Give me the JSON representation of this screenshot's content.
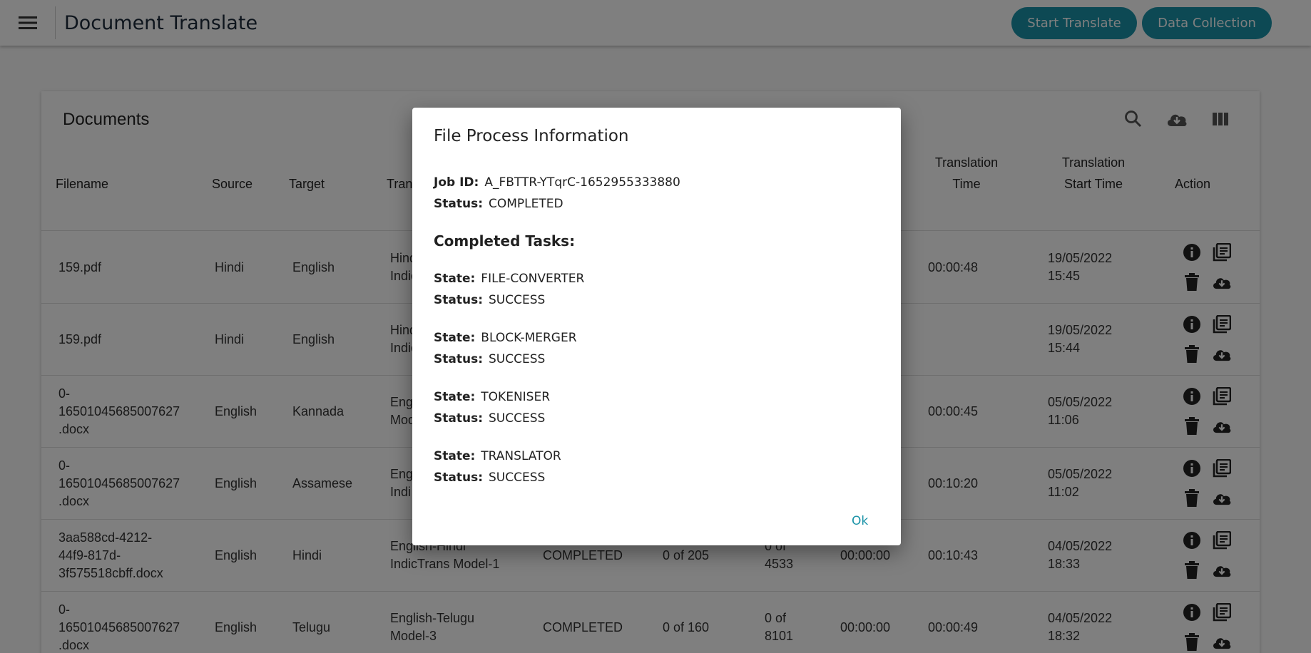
{
  "app": {
    "title": "Document Translate",
    "start_translate": "Start Translate",
    "data_collection": "Data Collection"
  },
  "card": {
    "title": "Documents",
    "headers": {
      "filename": "Filename",
      "source": "Source",
      "target": "Target",
      "trans_partial": "Tran",
      "translation_time_1": "Translation",
      "translation_time_2": "Time",
      "start_time_1": "Translation",
      "start_time_2": "Start Time",
      "action": "Action"
    },
    "rows": [
      {
        "filename": [
          "159.pdf"
        ],
        "source": "Hindi",
        "target": "English",
        "model": [
          "Hind",
          "Indic"
        ],
        "status": "",
        "sentences": "",
        "words": [],
        "zero_time": "",
        "time": "00:00:48",
        "start": [
          "19/05/2022",
          "15:45"
        ]
      },
      {
        "filename": [
          "159.pdf"
        ],
        "source": "Hindi",
        "target": "English",
        "model": [
          "Hind",
          "Indic"
        ],
        "status": "",
        "sentences": "",
        "words": [],
        "zero_time": "",
        "time": "",
        "start": [
          "19/05/2022",
          "15:44"
        ]
      },
      {
        "filename": [
          "0-",
          "16501045685007627",
          ".docx"
        ],
        "source": "English",
        "target": "Kannada",
        "model": [
          "Engl",
          "Mod"
        ],
        "status": "",
        "sentences": "",
        "words": [],
        "zero_time": "",
        "time": "00:00:45",
        "start": [
          "05/05/2022",
          "11:06"
        ]
      },
      {
        "filename": [
          "0-",
          "16501045685007627",
          ".docx"
        ],
        "source": "English",
        "target": "Assamese",
        "model": [
          "Engl",
          "Indi"
        ],
        "status": "",
        "sentences": "",
        "words": [],
        "zero_time": "",
        "time": "00:10:20",
        "start": [
          "05/05/2022",
          "11:02"
        ]
      },
      {
        "filename": [
          "3aa588cd-4212-",
          "44f9-817d-",
          "3f575518cbff.docx"
        ],
        "source": "English",
        "target": "Hindi",
        "model": [
          "English-Hindi",
          "IndicTrans Model-1"
        ],
        "status": "COMPLETED",
        "sentences": "0 of 205",
        "words": [
          "0 of",
          "4533"
        ],
        "zero_time": "00:00:00",
        "time": "00:10:43",
        "start": [
          "04/05/2022",
          "18:33"
        ]
      },
      {
        "filename": [
          "0-",
          "16501045685007627",
          ".docx"
        ],
        "source": "English",
        "target": "Telugu",
        "model": [
          "English-Telugu",
          "Model-3"
        ],
        "status": "COMPLETED",
        "sentences": "0 of 160",
        "words": [
          "0 of",
          "8101"
        ],
        "zero_time": "00:00:00",
        "time": "00:00:49",
        "start": [
          "04/05/2022",
          "18:32"
        ]
      }
    ]
  },
  "dialog": {
    "title": "File Process Information",
    "job_id_label": "Job ID:",
    "job_id": "A_FBTTR-YTqrC-1652955333880",
    "status_label": "Status:",
    "status": "COMPLETED",
    "completed_tasks": "Completed Tasks:",
    "state_label": "State:",
    "tasks": [
      {
        "state": "FILE-CONVERTER",
        "status": "SUCCESS"
      },
      {
        "state": "BLOCK-MERGER",
        "status": "SUCCESS"
      },
      {
        "state": "TOKENISER",
        "status": "SUCCESS"
      },
      {
        "state": "TRANSLATOR",
        "status": "SUCCESS"
      }
    ],
    "ok": "Ok"
  },
  "colors": {
    "accent": "#1b93a8",
    "overlay": "rgba(0,0,0,0.5)"
  }
}
